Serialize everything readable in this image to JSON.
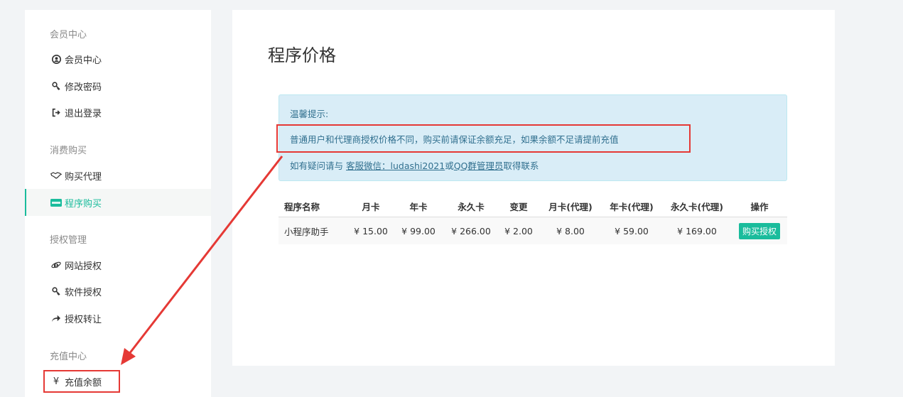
{
  "sidebar": {
    "groups": [
      {
        "title": "会员中心",
        "items": [
          {
            "icon": "user-circle-icon",
            "label": "会员中心"
          },
          {
            "icon": "key-icon",
            "label": "修改密码"
          },
          {
            "icon": "sign-out-icon",
            "label": "退出登录"
          }
        ]
      },
      {
        "title": "消费购买",
        "items": [
          {
            "icon": "handshake-icon",
            "label": "购买代理"
          },
          {
            "icon": "paypal-icon",
            "label": "程序购买",
            "active": true
          }
        ]
      },
      {
        "title": "授权管理",
        "items": [
          {
            "icon": "ie-icon",
            "label": "网站授权"
          },
          {
            "icon": "key-icon",
            "label": "软件授权"
          },
          {
            "icon": "share-icon",
            "label": "授权转让"
          }
        ]
      },
      {
        "title": "充值中心",
        "items": [
          {
            "icon": "yen-icon",
            "label": "充值余额"
          }
        ]
      }
    ]
  },
  "main": {
    "title": "程序价格",
    "alert": {
      "heading": "温馨提示:",
      "line1": "普通用户和代理商授权价格不同，购买前请保证余额充足，如果余额不足请提前充值",
      "line2_prefix": "如有疑问请与 ",
      "line2_link1": "客服微信：ludashi2021",
      "line2_mid": "或",
      "line2_link2": "QQ群管理员",
      "line2_suffix": "取得联系"
    },
    "table": {
      "headers": [
        "程序名称",
        "月卡",
        "年卡",
        "永久卡",
        "变更",
        "月卡(代理)",
        "年卡(代理)",
        "永久卡(代理)",
        "操作"
      ],
      "rows": [
        {
          "name": "小程序助手",
          "monthly": "¥ 15.00",
          "yearly": "¥ 99.00",
          "permanent": "¥ 266.00",
          "change": "¥ 2.00",
          "monthly_agent": "¥ 8.00",
          "yearly_agent": "¥ 59.00",
          "permanent_agent": "¥ 169.00",
          "action": "购买授权"
        }
      ]
    }
  },
  "colors": {
    "accent": "#1abc9c",
    "highlight": "#e53935",
    "alert_bg": "#d9edf7"
  }
}
